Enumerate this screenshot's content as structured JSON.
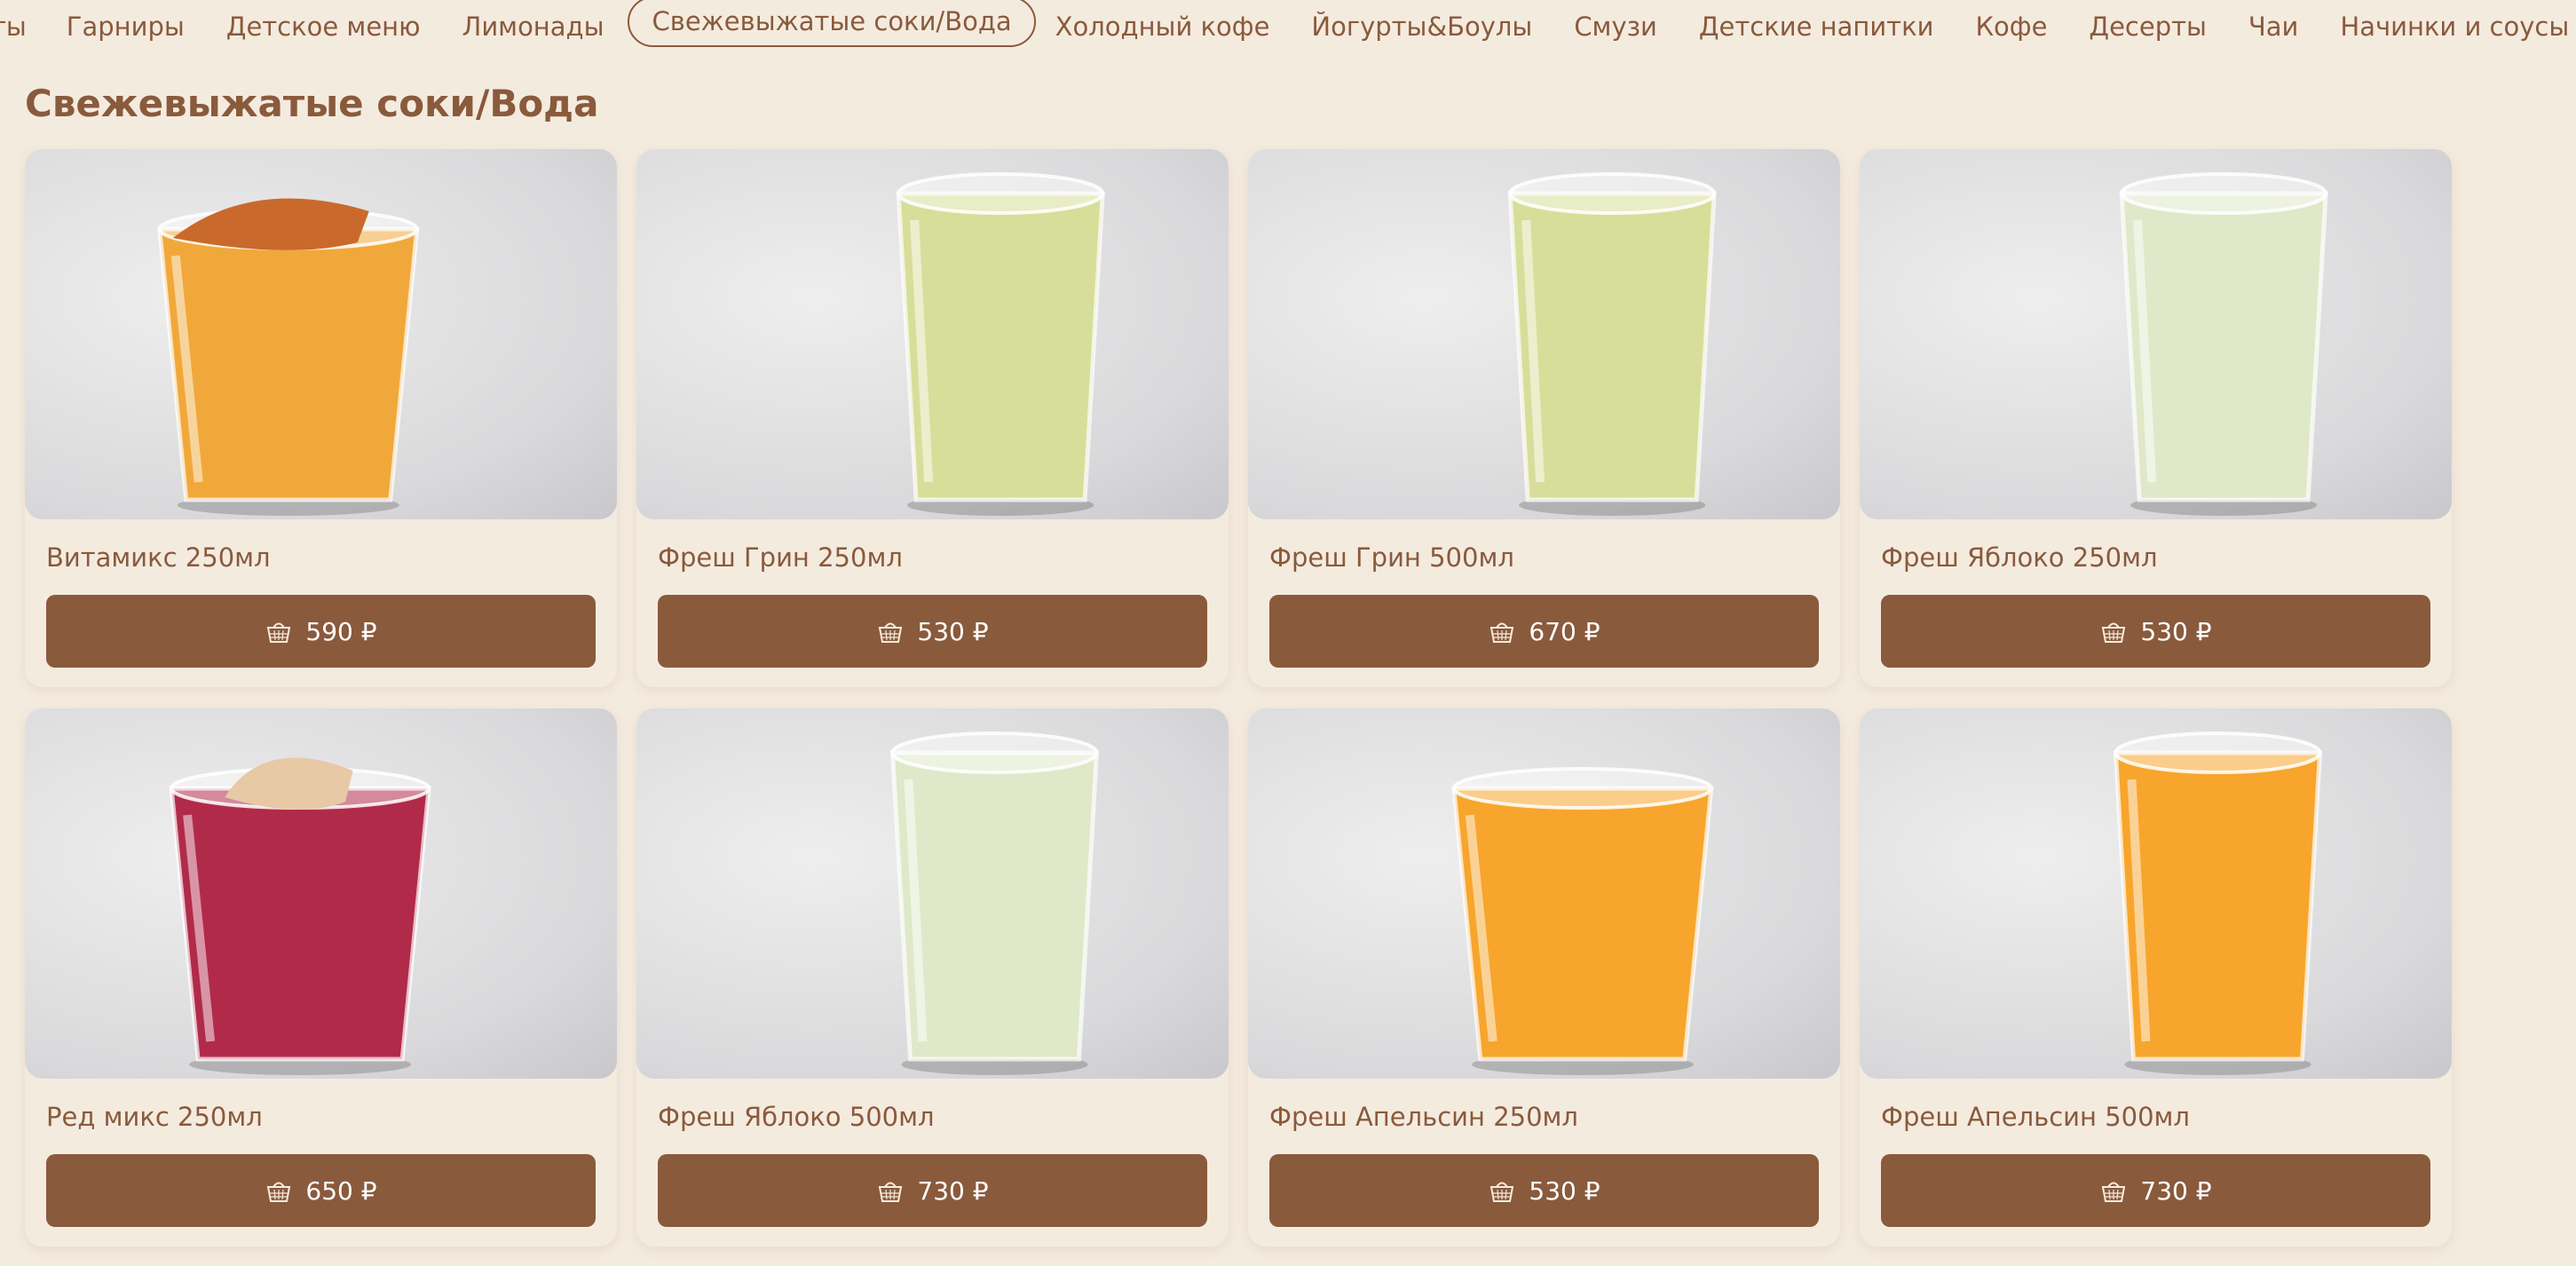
{
  "nav": {
    "items": [
      {
        "label": "ты"
      },
      {
        "label": "Гарниры"
      },
      {
        "label": "Детское меню"
      },
      {
        "label": "Лимонады"
      },
      {
        "label": "Свежевыжатые соки/Вода"
      },
      {
        "label": "Холодный кофе"
      },
      {
        "label": "Йогурты&Боулы"
      },
      {
        "label": "Смузи"
      },
      {
        "label": "Детские напитки"
      },
      {
        "label": "Кофе"
      },
      {
        "label": "Десерты"
      },
      {
        "label": "Чаи"
      },
      {
        "label": "Начинки и соусы"
      }
    ],
    "active_index": 4
  },
  "section": {
    "title": "Свежевыжатые соки/Вода"
  },
  "products": [
    {
      "name": "Витамикс 250мл",
      "price": "590 ₽",
      "drink_color": "#f1a83a",
      "topper": "chip-orange"
    },
    {
      "name": "Фреш Грин 250мл",
      "price": "530 ₽",
      "drink_color": "#d7de9a",
      "topper": ""
    },
    {
      "name": "Фреш Грин 500мл",
      "price": "670 ₽",
      "drink_color": "#d7de9a",
      "topper": ""
    },
    {
      "name": "Фреш Яблоко 250мл",
      "price": "530 ₽",
      "drink_color": "#dfe8c8",
      "topper": ""
    },
    {
      "name": "Ред микс 250мл",
      "price": "650 ₽",
      "drink_color": "#b12a4a",
      "topper": "chip-beige"
    },
    {
      "name": "Фреш Яблоко 500мл",
      "price": "730 ₽",
      "drink_color": "#dfe8c8",
      "topper": ""
    },
    {
      "name": "Фреш Апельсин 250мл",
      "price": "530 ₽",
      "drink_color": "#f7a52c",
      "topper": ""
    },
    {
      "name": "Фреш Апельсин 500мл",
      "price": "730 ₽",
      "drink_color": "#f7a52c",
      "topper": ""
    }
  ],
  "colors": {
    "accent": "#8a5a3c",
    "background": "#f4ebdf"
  },
  "icons": {
    "price_button": "basket-icon"
  }
}
